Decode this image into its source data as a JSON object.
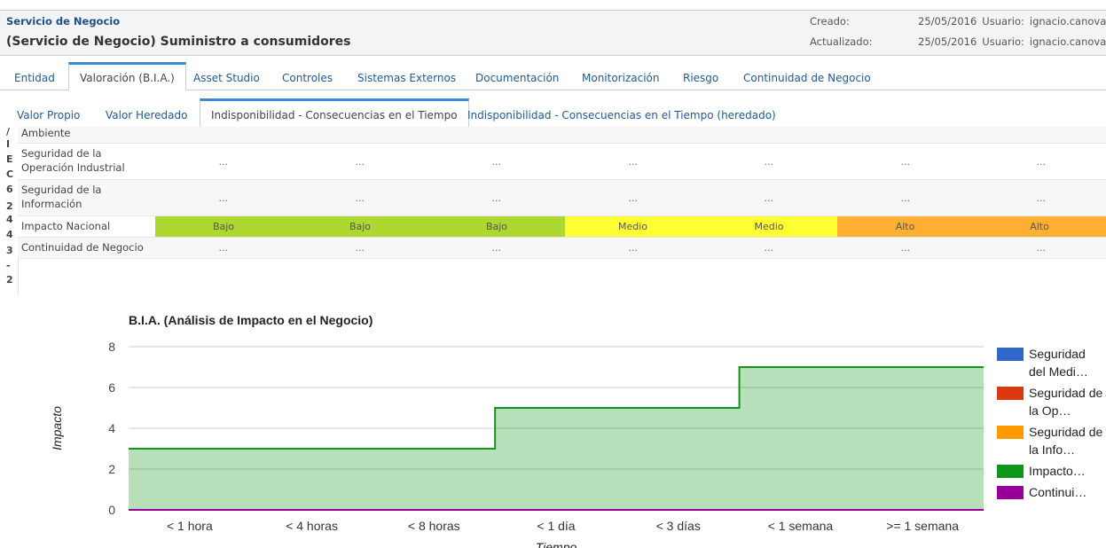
{
  "header": {
    "entity_type": "Servicio de Negocio",
    "title": "(Servicio de Negocio) Suministro a consumidores",
    "created_label": "Creado:",
    "created_date": "25/05/2016",
    "created_user_label": "Usuario:",
    "created_user": "ignacio.canovas",
    "updated_label": "Actualizado:",
    "updated_date": "25/05/2016",
    "updated_user_label": "Usuario:",
    "updated_user": "ignacio.canovas"
  },
  "main_tabs": [
    {
      "label": "Entidad",
      "active": false
    },
    {
      "label": "Valoración (B.I.A.)",
      "active": true
    },
    {
      "label": "Asset Studio",
      "active": false
    },
    {
      "label": "Controles",
      "active": false
    },
    {
      "label": "Sistemas Externos",
      "active": false
    },
    {
      "label": "Documentación",
      "active": false
    },
    {
      "label": "Monitorización",
      "active": false
    },
    {
      "label": "Riesgo",
      "active": false
    },
    {
      "label": "Continuidad de Negocio",
      "active": false
    }
  ],
  "sub_tabs": [
    {
      "label": "Valor Propio",
      "active": false
    },
    {
      "label": "Valor Heredado",
      "active": false
    },
    {
      "label": "Indisponibilidad - Consecuencias en el Tiempo",
      "active": true
    },
    {
      "label": "Indisponibilidad - Consecuencias en el Tiempo (heredado)",
      "active": false
    }
  ],
  "side_code": [
    "/",
    "I",
    "E",
    "C",
    "6",
    "2",
    "4",
    "4",
    "3",
    "-",
    "2"
  ],
  "grid": {
    "rows": [
      {
        "label": "Ambiente",
        "cells": []
      },
      {
        "label": "Seguridad de la Operación Industrial",
        "cells": [
          "...",
          "...",
          "...",
          "...",
          "...",
          "...",
          "..."
        ]
      },
      {
        "label": "Seguridad de la Información",
        "cells": [
          "...",
          "...",
          "...",
          "...",
          "...",
          "...",
          "..."
        ]
      },
      {
        "label": "Impacto Nacional",
        "cells": [
          "Bajo",
          "Bajo",
          "Bajo",
          "Medio",
          "Medio",
          "Alto",
          "Alto"
        ]
      },
      {
        "label": "Continuidad de Negocio",
        "cells": [
          "...",
          "...",
          "...",
          "...",
          "...",
          "...",
          "..."
        ]
      }
    ],
    "level_colors": {
      "Bajo": "#add82f",
      "Medio": "#ffff33",
      "Alto": "#ffb032"
    }
  },
  "chart_data": {
    "type": "area",
    "title": "B.I.A. (Análisis de Impacto en el Negocio)",
    "xlabel": "Tiempo",
    "ylabel": "Impacto",
    "categories": [
      "< 1 hora",
      "< 4 horas",
      "< 8 horas",
      "< 1 día",
      "< 3 días",
      "< 1 semana",
      ">= 1 semana"
    ],
    "ylim": [
      0,
      8
    ],
    "yticks": [
      0,
      2,
      4,
      6,
      8
    ],
    "grid": true,
    "legend_position": "right",
    "step": true,
    "series": [
      {
        "name": "Seguridad del Medi…",
        "color": "#3366cc",
        "values": [
          0,
          0,
          0,
          0,
          0,
          0,
          0
        ]
      },
      {
        "name": "Seguridad de la Op…",
        "color": "#dc3912",
        "values": [
          0,
          0,
          0,
          0,
          0,
          0,
          0
        ]
      },
      {
        "name": "Seguridad de la Info…",
        "color": "#ff9900",
        "values": [
          0,
          0,
          0,
          0,
          0,
          0,
          0
        ]
      },
      {
        "name": "Impacto…",
        "color": "#109618",
        "values": [
          3,
          3,
          3,
          5,
          5,
          7,
          7
        ]
      },
      {
        "name": "Continui…",
        "color": "#990099",
        "values": [
          0,
          0,
          0,
          0,
          0,
          0,
          0
        ]
      }
    ]
  }
}
